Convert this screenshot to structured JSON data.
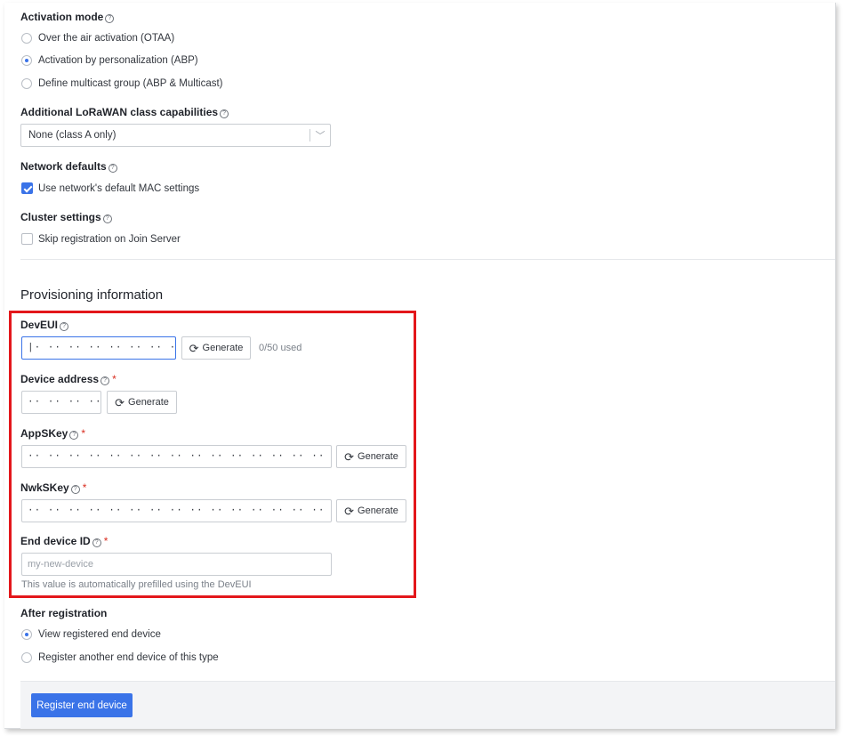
{
  "activation": {
    "label": "Activation mode",
    "options": [
      {
        "label": "Over the air activation (OTAA)",
        "selected": false
      },
      {
        "label": "Activation by personalization (ABP)",
        "selected": true
      },
      {
        "label": "Define multicast group (ABP & Multicast)",
        "selected": false
      }
    ]
  },
  "class_capabilities": {
    "label": "Additional LoRaWAN class capabilities",
    "selected": "None (class A only)"
  },
  "network_defaults": {
    "label": "Network defaults",
    "checkbox_label": "Use network's default MAC settings",
    "checked": true
  },
  "cluster_settings": {
    "label": "Cluster settings",
    "checkbox_label": "Skip registration on Join Server",
    "checked": false
  },
  "provisioning": {
    "title": "Provisioning information",
    "deveui": {
      "label": "DevEUI",
      "value": "|· ·· ·· ·· ·· ·· ·· ··",
      "generate": "Generate",
      "usage": "0/50 used"
    },
    "device_address": {
      "label": "Device address",
      "required": "*",
      "value": "·· ·· ·· ··",
      "generate": "Generate"
    },
    "appskey": {
      "label": "AppSKey",
      "required": "*",
      "value": "·· ·· ·· ·· ·· ·· ·· ·· ·· ·· ·· ·· ·· ·· ·· ··",
      "generate": "Generate"
    },
    "nwkskey": {
      "label": "NwkSKey",
      "required": "*",
      "value": "·· ·· ·· ·· ·· ·· ·· ·· ·· ·· ·· ·· ·· ·· ·· ··",
      "generate": "Generate"
    },
    "end_device_id": {
      "label": "End device ID",
      "required": "*",
      "placeholder": "my-new-device",
      "hint": "This value is automatically prefilled using the DevEUI"
    }
  },
  "after_registration": {
    "label": "After registration",
    "options": [
      {
        "label": "View registered end device",
        "selected": true
      },
      {
        "label": "Register another end device of this type",
        "selected": false
      }
    ]
  },
  "submit": {
    "label": "Register end device"
  },
  "icons": {
    "help": "?",
    "refresh": "⟳",
    "chevron": "﹀"
  },
  "colors": {
    "accent": "#3a73e8",
    "highlight": "#e3171b",
    "required": "#d92d20"
  }
}
